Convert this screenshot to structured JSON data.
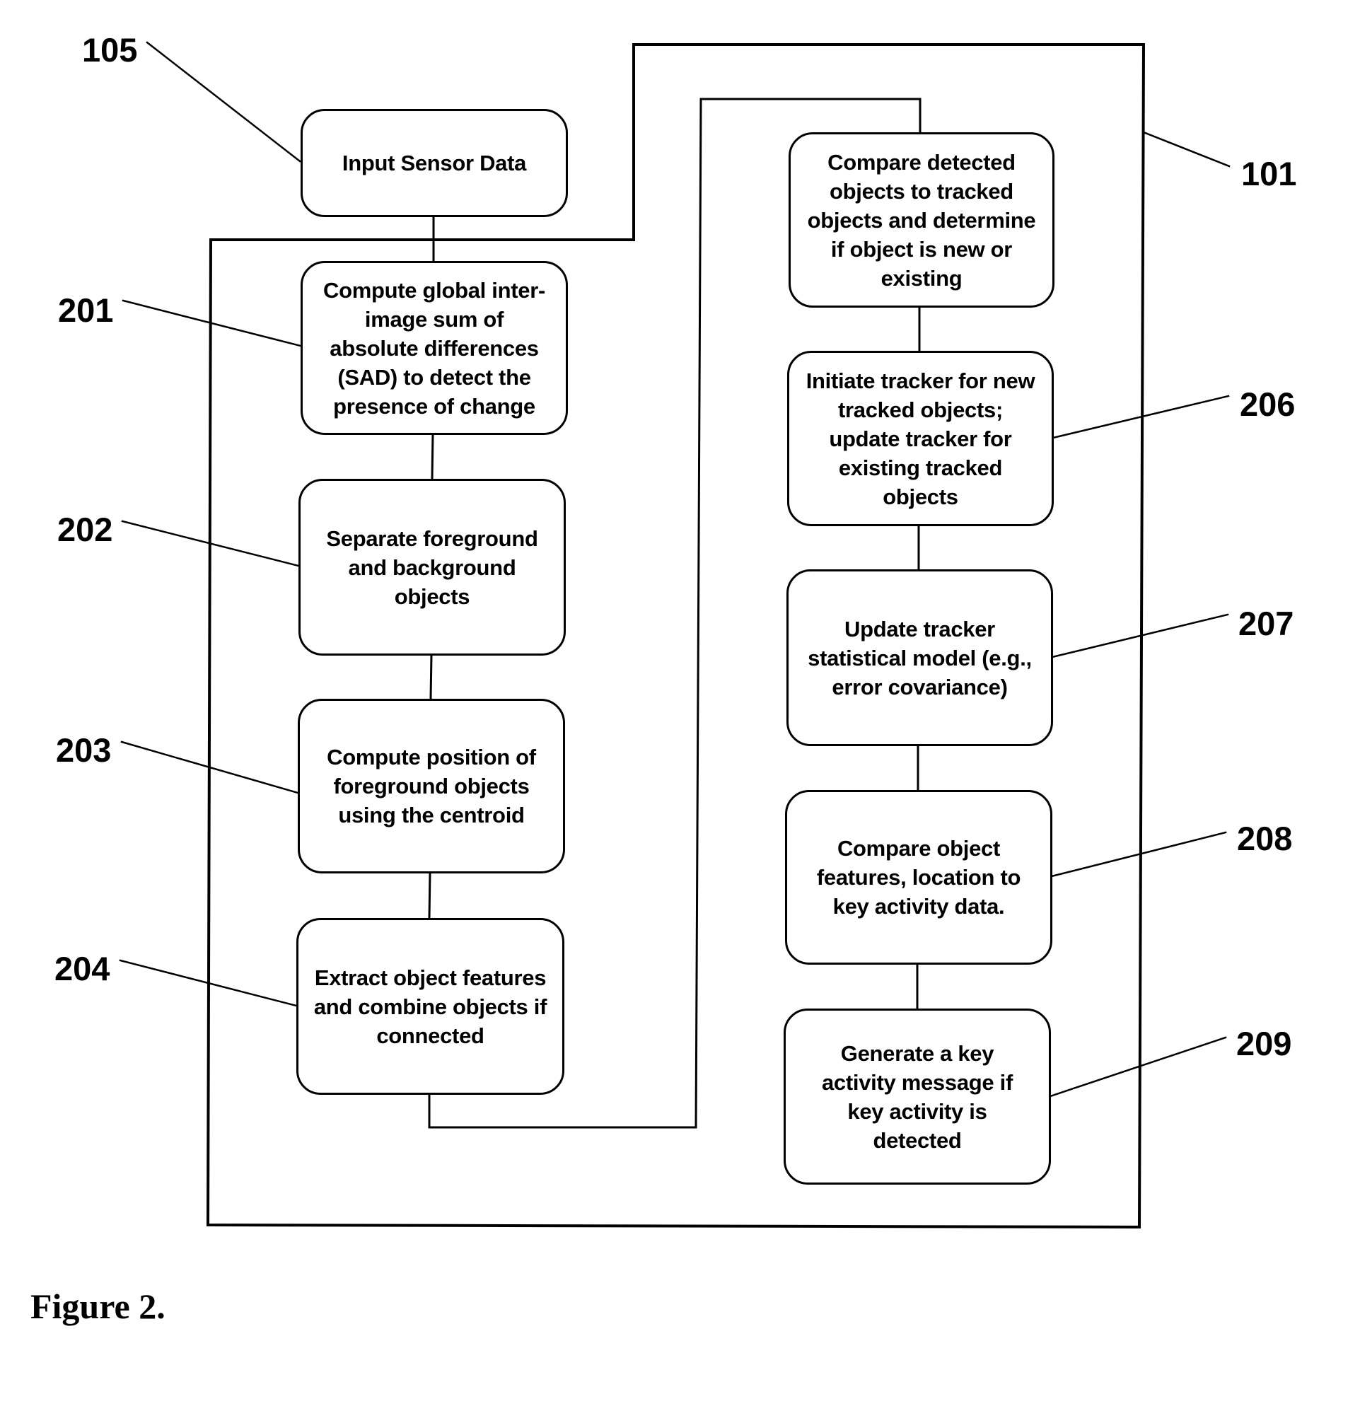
{
  "figure": {
    "caption": "Figure 2."
  },
  "reference_labels": {
    "input": "105",
    "system": "101",
    "step_201": "201",
    "step_202": "202",
    "step_203": "203",
    "step_204": "204",
    "step_206": "206",
    "step_207": "207",
    "step_208": "208",
    "step_209": "209"
  },
  "nodes": {
    "input": "Input Sensor Data",
    "step_201": "Compute global inter-\nimage sum of\nabsolute differences\n(SAD) to detect the\npresence of change",
    "step_202": "Separate foreground\nand background\nobjects",
    "step_203": "Compute position of\nforeground objects\nusing the centroid",
    "step_204": "Extract object features\nand combine objects if\nconnected",
    "step_205": "Compare detected\nobjects to tracked\nobjects and determine\nif object is new or\nexisting",
    "step_206": "Initiate tracker for new\ntracked objects;\nupdate tracker for\nexisting tracked\nobjects",
    "step_207": "Update tracker\nstatistical model (e.g.,\nerror covariance)",
    "step_208": "Compare object\nfeatures, location to\nkey activity data.",
    "step_209": "Generate a key\nactivity message if\nkey activity is\ndetected"
  }
}
